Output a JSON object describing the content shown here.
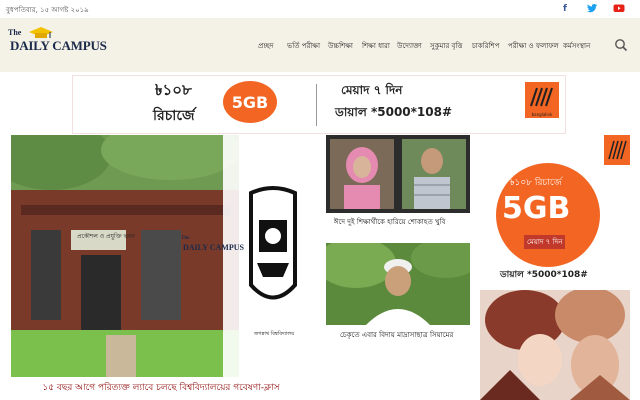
{
  "topbar": {
    "date": "বুধপতিবার, ১৫ আগষ্ট ২০১৯",
    "social_icons": [
      "facebook-icon",
      "twitter-icon",
      "youtube-icon"
    ]
  },
  "brand": {
    "the": "The",
    "name": "DAILY CAMPUS"
  },
  "nav": {
    "items": [
      "প্রচ্ছদ",
      "ভর্তি পরীক্ষা",
      "উচ্চশিক্ষা",
      "শিক্ষা ধারা",
      "উদ্যোক্তা",
      "সুকুমার বৃত্তি",
      "চাকরিশিপ",
      "পরীক্ষা ও ফলাফল",
      "কর্মসংস্থান"
    ]
  },
  "banner_ad": {
    "price": "৳১০৮",
    "recharge": "রিচার্জে",
    "data": "5GB",
    "validity": "মেয়াদ ৭ দিন",
    "dial": "ডায়াল *5000*108#",
    "brand_tag": "banglalink"
  },
  "lead_story": {
    "caption": "১৫ বছর আগে পরিত্যক্ত ল্যাবে চলছে বিশ্ববিদ্যালয়ের গবেষণা-ক্লাস",
    "sign_text": "প্রকৌশল ও প্রযুক্তি ভবন",
    "watermark_the": "The",
    "watermark_name": "DAILY CAMPUS",
    "emblem_text": "জগন্নাথ বিশ্ববিদ্যালয়"
  },
  "stories": [
    {
      "caption": "ঈদে দুই শিক্ষার্থীকে হারিয়ে শোকাহত খুবি"
    },
    {
      "caption": "চেকৃতে এবার বিদায় মাদ্রাসাছাত্র সিয়ামের"
    }
  ],
  "side_ad": {
    "price": "৳১০৮ রিচার্জে",
    "data": "5GB",
    "validity": "মেয়াদ ৭ দিন",
    "dial": "ডায়াল *5000*108#"
  },
  "colors": {
    "header_bg": "#f4f1e6",
    "brand_orange": "#f26522",
    "headline_red": "#8b0000",
    "facebook": "#3b5998",
    "twitter": "#1da1f2",
    "youtube": "#e62117"
  }
}
